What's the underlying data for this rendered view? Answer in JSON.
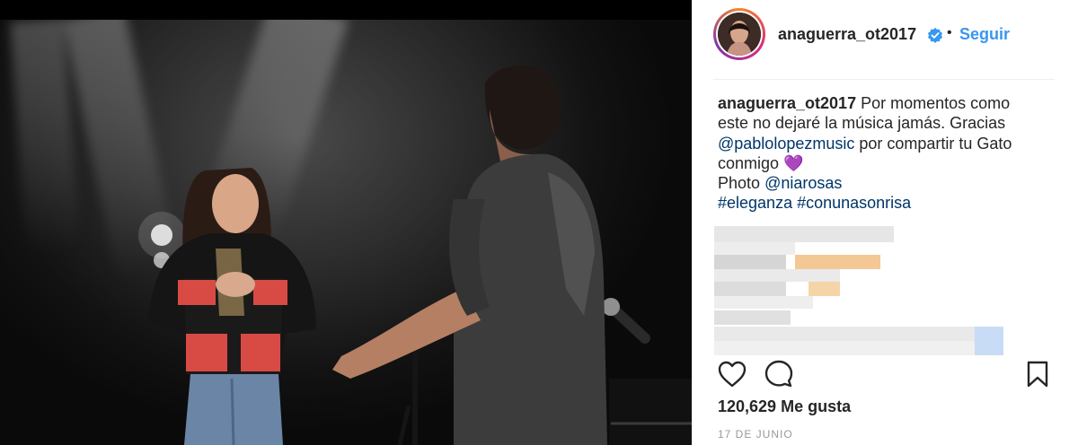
{
  "post": {
    "username": "anaguerra_ot2017",
    "verified": true,
    "separator": "•",
    "follow_label": "Seguir",
    "caption": {
      "username": "anaguerra_ot2017",
      "line1": "Por momentos como",
      "line2": "este no dejaré la música jamás. Gracias",
      "mention1": "@pablolopezmusic",
      "line3_rest": "por compartir tu Gato",
      "line4": "conmigo",
      "emoji": "💜",
      "photo_label": "Photo",
      "mention2": "@niarosas",
      "hashtag1": "#eleganza",
      "hashtag2": "#conunasonrisa"
    },
    "likes_count": "120,629",
    "likes_label": "Me gusta",
    "date": "17 DE JUNIO"
  },
  "icons": {
    "like": "heart-icon",
    "comment": "comment-icon",
    "save": "bookmark-icon",
    "verified": "verified-badge-icon"
  },
  "colors": {
    "link": "#003569",
    "follow": "#3897f0",
    "verified": "#3897f0",
    "text": "#262626",
    "muted": "#999999"
  }
}
